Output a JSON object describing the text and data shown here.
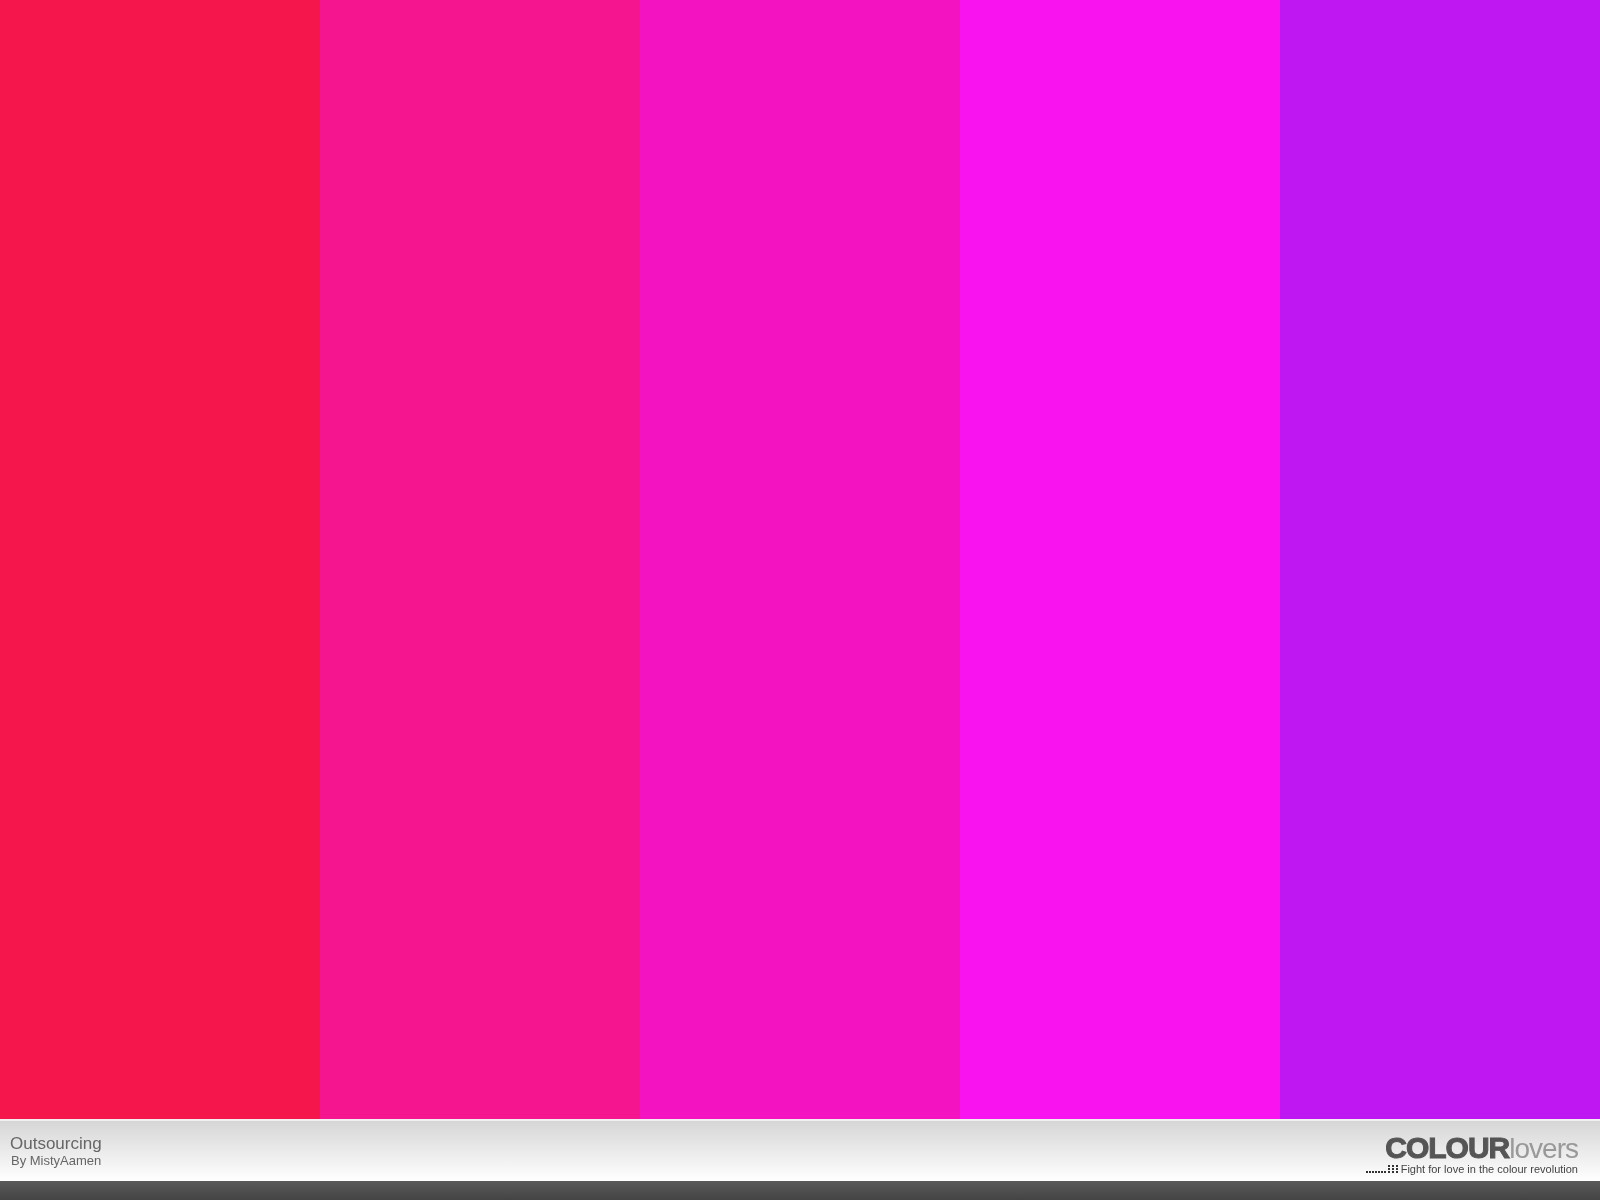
{
  "swatches": [
    {
      "color": "#f5164c"
    },
    {
      "color": "#f5158f"
    },
    {
      "color": "#f313c0"
    },
    {
      "color": "#f813ef"
    },
    {
      "color": "#bf17f2"
    }
  ],
  "palette": {
    "title": "Outsourcing",
    "author": "By MistyAamen"
  },
  "logo": {
    "bold": "COLOUR",
    "light": "lovers",
    "tagline": "Fight for love in the colour revolution"
  }
}
